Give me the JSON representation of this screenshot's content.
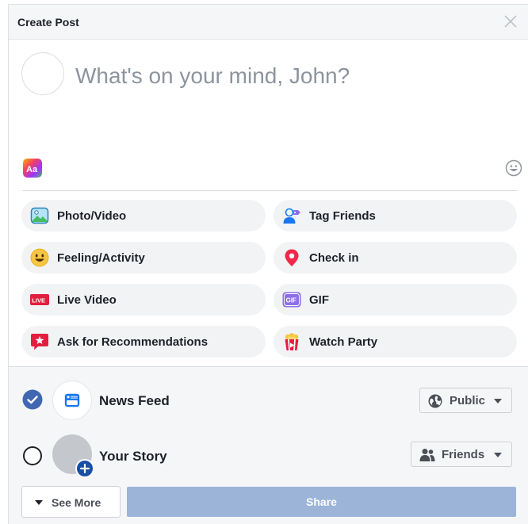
{
  "header": {
    "title": "Create Post"
  },
  "composer": {
    "placeholder": "What's on your mind, John?"
  },
  "options": [
    {
      "label": "Photo/Video",
      "icon": "photo-video-icon"
    },
    {
      "label": "Tag Friends",
      "icon": "tag-friends-icon"
    },
    {
      "label": "Feeling/Activity",
      "icon": "feeling-emoji-icon"
    },
    {
      "label": "Check in",
      "icon": "location-pin-icon"
    },
    {
      "label": "Live Video",
      "icon": "live-badge-icon",
      "badge": "LIVE"
    },
    {
      "label": "GIF",
      "icon": "gif-icon",
      "badge": "GIF"
    },
    {
      "label": "Ask for Recommendations",
      "icon": "recommendation-star-icon"
    },
    {
      "label": "Watch Party",
      "icon": "popcorn-icon"
    }
  ],
  "audience": {
    "news_feed": {
      "label": "News Feed",
      "checked": true,
      "privacy": "Public",
      "privacy_icon": "globe-icon"
    },
    "your_story": {
      "label": "Your Story",
      "checked": false,
      "privacy": "Friends",
      "privacy_icon": "friends-icon"
    }
  },
  "buttons": {
    "see_more": "See More",
    "share": "Share"
  },
  "colors": {
    "brand_blue": "#4267b2",
    "share_disabled": "#9cb4d8",
    "live_red": "#e41e3f",
    "pin_red": "#f02849",
    "gif_purple": "#8c6fe8"
  }
}
